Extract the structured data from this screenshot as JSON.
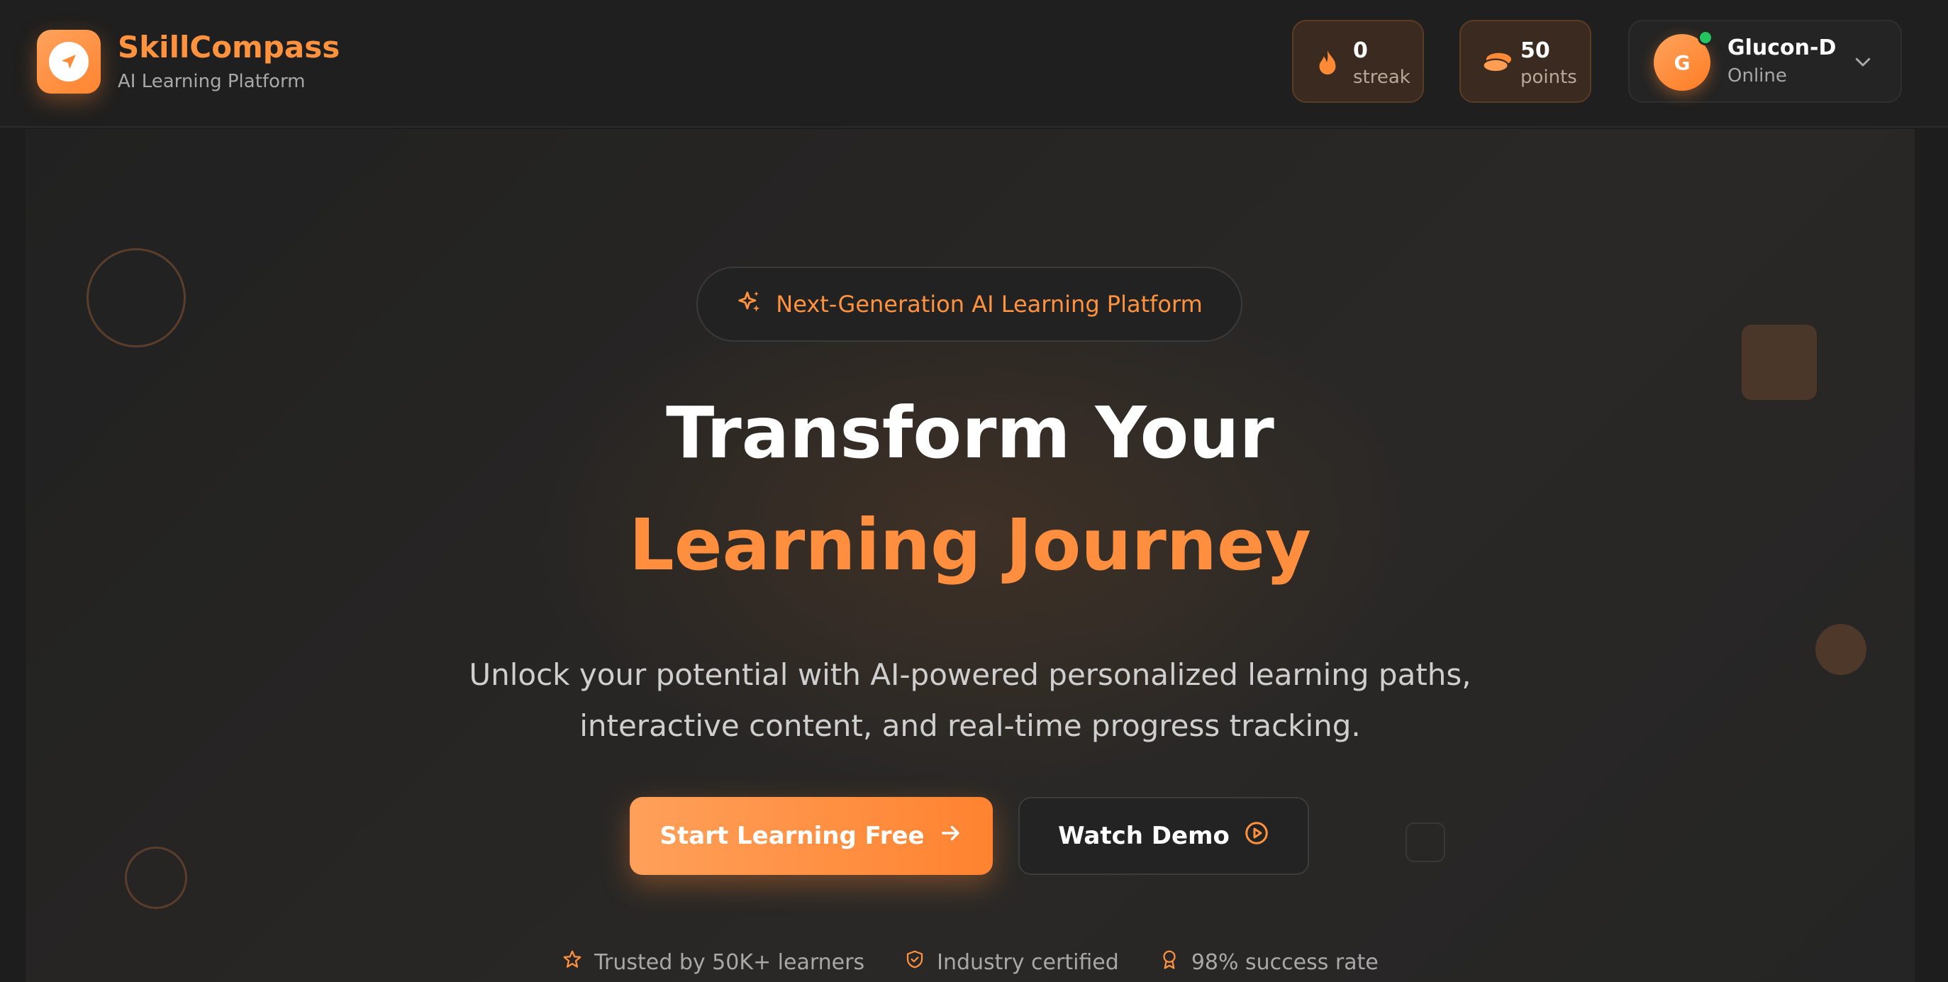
{
  "brand": {
    "name": "SkillCompass",
    "subtitle": "AI Learning Platform",
    "logo_icon": "send-icon"
  },
  "stats": {
    "streak": {
      "value": "0",
      "label": "streak",
      "icon": "flame-icon"
    },
    "points": {
      "value": "50",
      "label": "points",
      "icon": "coins-icon"
    }
  },
  "user": {
    "initial": "G",
    "name": "Glucon-D",
    "status": "Online",
    "status_color": "#22c55e"
  },
  "hero": {
    "tag": "Next-Generation AI Learning Platform",
    "headline_line1": "Transform Your",
    "headline_line2": "Learning Journey",
    "description": "Unlock your potential with AI-powered personalized learning paths, interactive content, and real-time progress tracking.",
    "primary_cta": "Start Learning Free",
    "secondary_cta": "Watch Demo",
    "trust": [
      {
        "icon": "star-icon",
        "text": "Trusted by 50K+ learners"
      },
      {
        "icon": "shield-check-icon",
        "text": "Industry certified"
      },
      {
        "icon": "award-icon",
        "text": "98% success rate"
      }
    ]
  },
  "colors": {
    "accent": "#ff923f",
    "background": "#1d1d1d"
  }
}
